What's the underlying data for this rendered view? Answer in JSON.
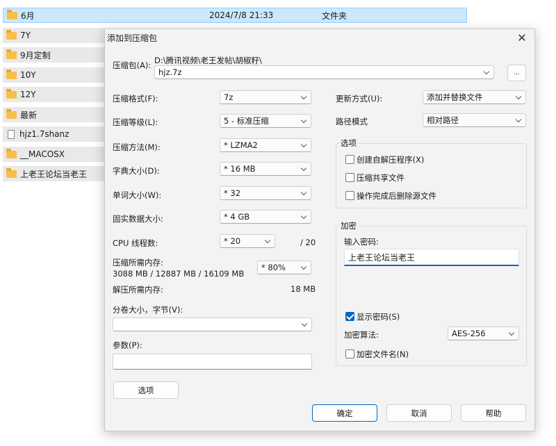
{
  "explorer": {
    "rows": [
      {
        "name": "6月",
        "date": "2024/7/8 21:33",
        "type": "文件夹",
        "icon": "folder-icon"
      },
      {
        "name": "7Y",
        "icon": "folder-icon"
      },
      {
        "name": "9月定制",
        "icon": "folder-icon"
      },
      {
        "name": "10Y",
        "icon": "folder-icon"
      },
      {
        "name": "12Y",
        "icon": "folder-icon"
      },
      {
        "name": "最新",
        "icon": "folder-icon"
      },
      {
        "name": "hjz1.7shanz",
        "icon": "file-icon"
      },
      {
        "name": "__MACOSX",
        "icon": "folder-icon"
      },
      {
        "name": "上老王论坛当老王",
        "icon": "folder-icon"
      }
    ]
  },
  "dialog": {
    "title": "添加到压缩包",
    "archive": {
      "label": "压缩包(A):",
      "path": "D:\\腾讯视频\\老王发帖\\胡椒籽\\",
      "filename": "hjz.7z",
      "browse_label": "..."
    },
    "format": {
      "label": "压缩格式(F):",
      "value": "7z"
    },
    "level": {
      "label": "压缩等级(L):",
      "value": "5 - 标准压缩"
    },
    "method": {
      "label": "压缩方法(M):",
      "value": "* LZMA2"
    },
    "dict": {
      "label": "字典大小(D):",
      "value": "* 16 MB"
    },
    "word": {
      "label": "单词大小(W):",
      "value": "* 32"
    },
    "solid": {
      "label": "固实数据大小:",
      "value": "* 4 GB"
    },
    "threads": {
      "label": "CPU 线程数:",
      "value": "* 20",
      "max": "/ 20"
    },
    "mem_compress": {
      "label": "压缩所需内存:",
      "detail": "3088 MB / 12887 MB / 16109 MB",
      "value": "* 80%"
    },
    "mem_decompress": {
      "label": "解压所需内存:",
      "value": "18 MB"
    },
    "volume": {
      "label": "分卷大小，字节(V):",
      "value": ""
    },
    "params": {
      "label": "参数(P):",
      "value": ""
    },
    "options_button": "选项",
    "update_mode": {
      "label": "更新方式(U):",
      "value": "添加并替换文件"
    },
    "path_mode": {
      "label": "路径模式",
      "value": "相对路径"
    },
    "options_group": {
      "title": "选项",
      "sfx": "创建自解压程序(X)",
      "shared": "压缩共享文件",
      "delete": "操作完成后删除源文件"
    },
    "encryption": {
      "title": "加密",
      "password_label": "输入密码:",
      "password_value": "上老王论坛当老王",
      "show_password": "显示密码(S)",
      "method_label": "加密算法:",
      "method_value": "AES-256",
      "encrypt_names": "加密文件名(N)"
    },
    "buttons": {
      "ok": "确定",
      "cancel": "取消",
      "help": "帮助"
    }
  },
  "colors": {
    "accent": "#0067c0",
    "selection": "#cce8ff",
    "folder": "#f6c04a"
  }
}
